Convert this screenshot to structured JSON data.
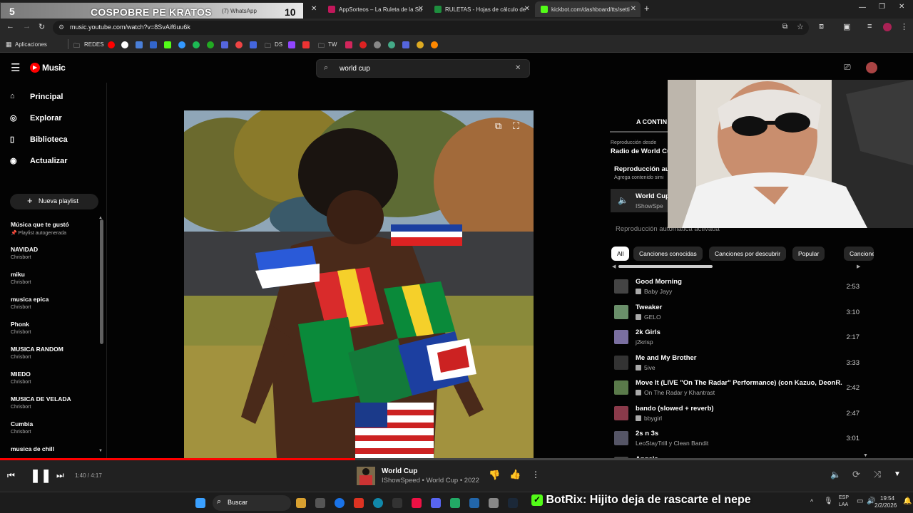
{
  "overlay": {
    "left_num": "5",
    "banner": "COSPOBRE PE KRATOS",
    "right_num": "10",
    "obscured_tab": "(7) WhatsApp"
  },
  "tabs": [
    {
      "label": "AppSorteos – La Ruleta de la Su",
      "color": "#c2185b"
    },
    {
      "label": "RULETAS - Hojas de cálculo de",
      "color": "#1e8e3e"
    },
    {
      "label": "kickbot.com/dashboard/tts/setti",
      "color": "#53fc18"
    }
  ],
  "url": "music.youtube.com/watch?v=8SvAif6uu6k",
  "bookmarks": {
    "apps": "Aplicaciones",
    "redes": "REDES",
    "ds": "DS",
    "tw": "TW"
  },
  "app": {
    "logo": "Music",
    "search_value": "world cup"
  },
  "sidebar": {
    "nav": [
      {
        "label": "Principal",
        "icon": "home-icon"
      },
      {
        "label": "Explorar",
        "icon": "explore-icon"
      },
      {
        "label": "Biblioteca",
        "icon": "library-icon"
      },
      {
        "label": "Actualizar",
        "icon": "upgrade-icon"
      }
    ],
    "new_playlist": "Nueva playlist",
    "playlists": [
      {
        "title": "Música que te gustó",
        "sub": "Playlist autogenerada"
      },
      {
        "title": "NAVIDAD",
        "sub": "Chrisbort"
      },
      {
        "title": "miku",
        "sub": "Chrisbort"
      },
      {
        "title": "musica epica",
        "sub": "Chrisbort"
      },
      {
        "title": "Phonk",
        "sub": "Chrisbort"
      },
      {
        "title": "MUSICA RANDOM",
        "sub": "Chrisbort"
      },
      {
        "title": "MIEDO",
        "sub": "Chrisbort"
      },
      {
        "title": "MUSICA DE VELADA",
        "sub": "Chrisbort"
      },
      {
        "title": "Cumbia",
        "sub": "Chrisbort"
      },
      {
        "title": "musica de chill",
        "sub": ""
      }
    ]
  },
  "queue": {
    "heading": "A CONTIN",
    "from_label": "Reproducción desde",
    "from_value": "Radio de World Cu",
    "autoplay_label": "Reproducción au",
    "autoplay_sub": "Agrega contenido simi",
    "current": {
      "title": "World Cup",
      "artist": "IShowSpe"
    },
    "autoplay_on": "Reproducción automática activada",
    "chips": [
      "All",
      "Canciones conocidas",
      "Canciones por descubrir",
      "Popular",
      "Canciones"
    ],
    "items": [
      {
        "title": "Good Morning",
        "artist": "Baby Jayy",
        "duration": "2:53",
        "explicit": true,
        "thumb": "#444"
      },
      {
        "title": "Tweaker",
        "artist": "GELO",
        "duration": "3:10",
        "explicit": true,
        "thumb": "#6a8f6a"
      },
      {
        "title": "2k Girls",
        "artist": "j2krisp",
        "duration": "2:17",
        "explicit": false,
        "thumb": "#7a6fa0"
      },
      {
        "title": "Me and My Brother",
        "artist": "5ive",
        "duration": "3:33",
        "explicit": true,
        "thumb": "#333"
      },
      {
        "title": "Move It (LIVE \"On The Radar\" Performance) (con Kazuo, DeonR...",
        "artist": "On The Radar y Khantrast",
        "duration": "2:42",
        "explicit": true,
        "thumb": "#5a7a4a"
      },
      {
        "title": "bando (slowed + reverb)",
        "artist": "bbygirl",
        "duration": "2:47",
        "explicit": true,
        "thumb": "#8a3a4a"
      },
      {
        "title": "2s n 3s",
        "artist": "LeoStayTrill y Clean Bandit",
        "duration": "3:01",
        "explicit": false,
        "thumb": "#556"
      },
      {
        "title": "Angels",
        "artist": "",
        "duration": "",
        "explicit": false,
        "thumb": "#444"
      }
    ]
  },
  "player": {
    "time": "1:40 / 4:17",
    "progress": 0.389,
    "title": "World Cup",
    "subtitle": "IShowSpeed • World Cup • 2022"
  },
  "taskbar": {
    "search": "Buscar",
    "chat": "BotRix: Hijito deja de rascarte el nepe",
    "lang": "ESP",
    "region": "LAA",
    "time": "19:54",
    "date": "2/2/2026"
  },
  "colors": {
    "accent": "#ff0000",
    "bg": "#030303",
    "panel": "#212121"
  }
}
